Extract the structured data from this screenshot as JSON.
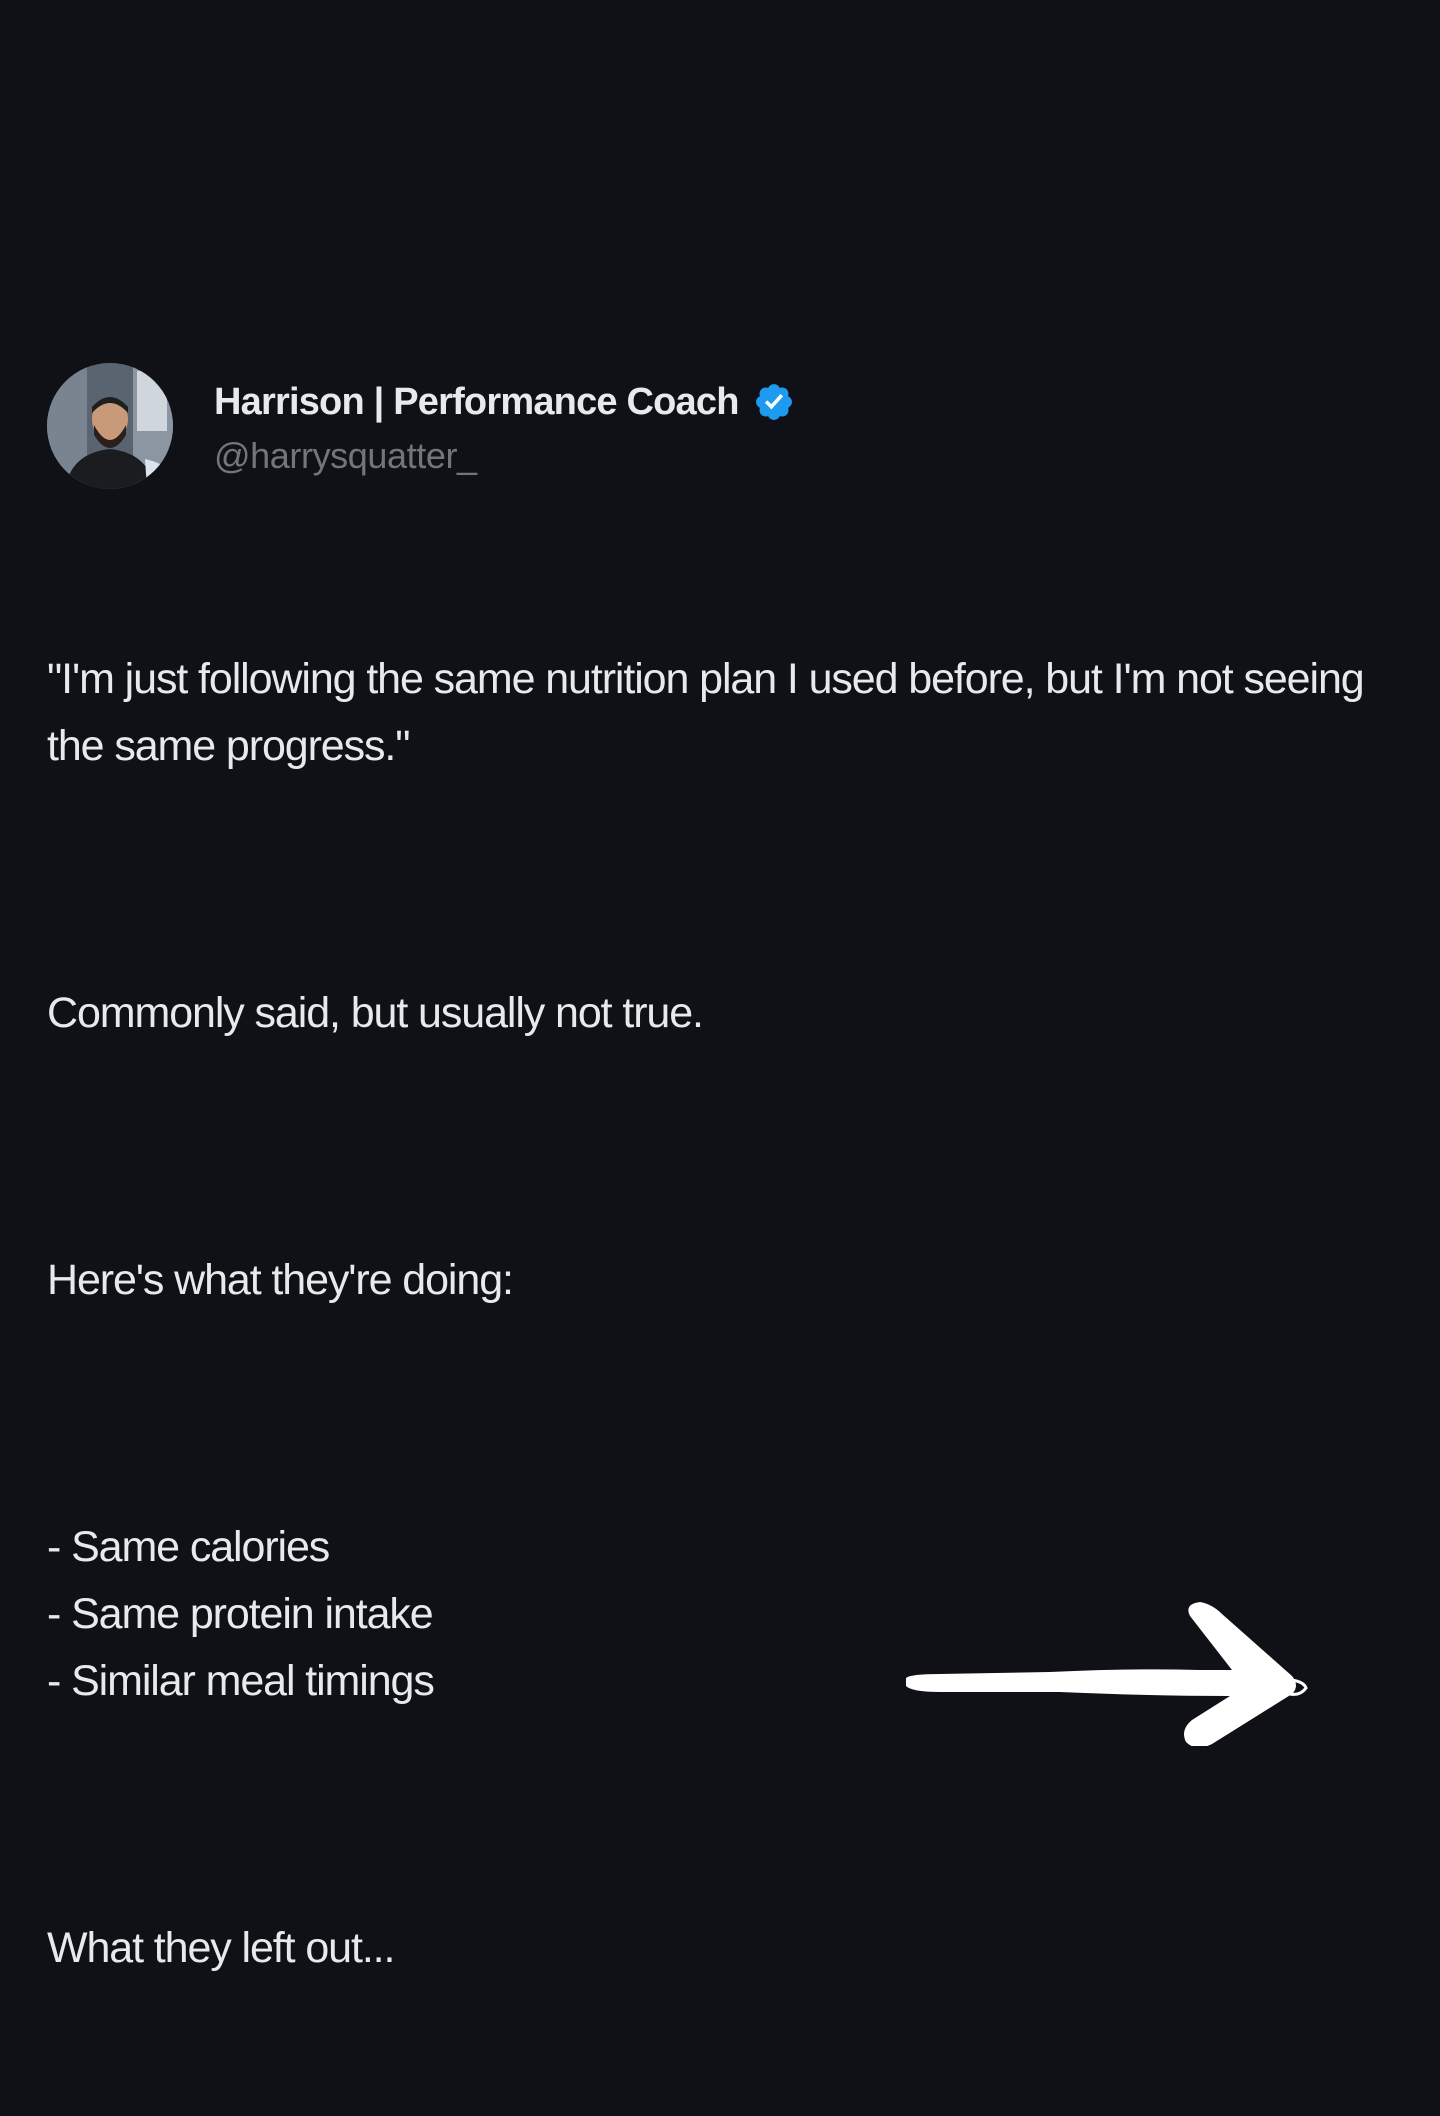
{
  "post": {
    "author": {
      "display_name": "Harrison | Performance Coach",
      "handle": "@harrysquatter_",
      "verified": true,
      "verified_badge_color": "#1d9bf0",
      "avatar_icon": "user-avatar"
    },
    "paragraphs": [
      "\"I'm just following the same nutrition plan I used before, but I'm not seeing the same progress.\"",
      "Commonly said, but usually not true.",
      "Here's what they're doing:"
    ],
    "list_items": [
      "- Same calories",
      "- Same protein intake",
      "- Similar meal timings"
    ],
    "closing": "What they left out..."
  },
  "decor": {
    "next_arrow_icon": "hand-drawn-arrow-right-icon",
    "arrow_color": "#ffffff"
  },
  "colors": {
    "background": "#0f1117",
    "text_primary": "#e7e9ea",
    "text_secondary": "#71767b"
  }
}
